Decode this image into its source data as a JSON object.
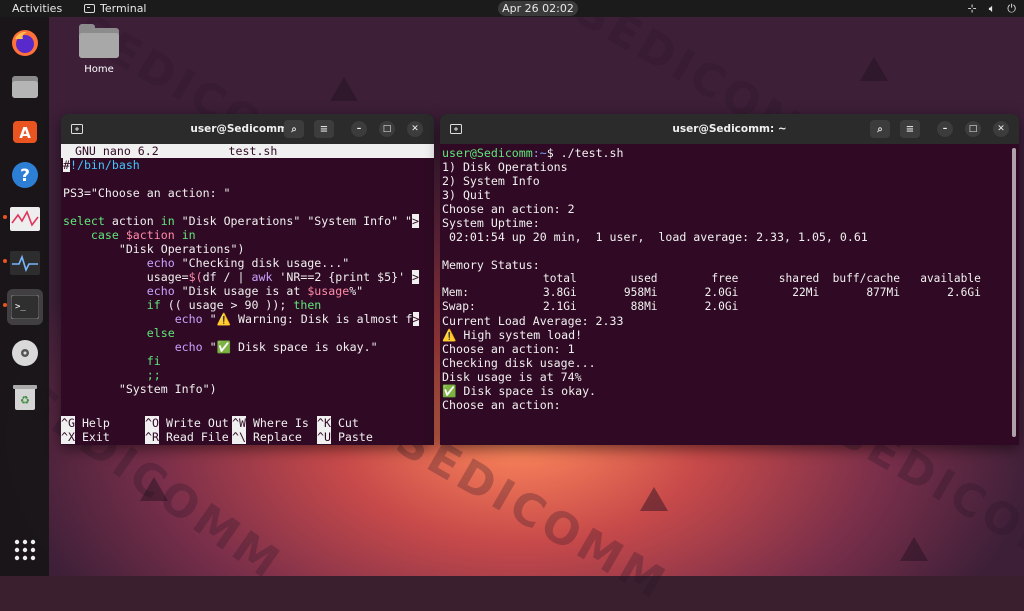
{
  "topbar": {
    "activities": "Activities",
    "app": "Terminal",
    "clock": "Apr 26  02:02"
  },
  "desktop": {
    "home_label": "Home",
    "watermark": "SEDICOMM"
  },
  "left_window": {
    "title": "user@Sedicomm: ~",
    "nano_header": "  GNU nano 6.2          test.sh",
    "lines": [
      "#!/bin/bash",
      "",
      "PS3=\"Choose an action: \"",
      "",
      "select action in \"Disk Operations\" \"System Info\" \"",
      "    case $action in",
      "        \"Disk Operations\")",
      "            echo \"Checking disk usage...\"",
      "            usage=$(df / | awk 'NR==2 {print $5}' ",
      "            echo \"Disk usage is at $usage%\"",
      "            if (( usage > 90 )); then",
      "                echo \"⚠️ Warning: Disk is almost f",
      "            else",
      "                echo \"✅ Disk space is okay.\"",
      "            fi",
      "            ;;",
      "        \"System Info\")"
    ],
    "shortcuts": [
      {
        "key": "^G",
        "label": "Help"
      },
      {
        "key": "^O",
        "label": "Write Out"
      },
      {
        "key": "^W",
        "label": "Where Is"
      },
      {
        "key": "^K",
        "label": "Cut"
      },
      {
        "key": "^X",
        "label": "Exit"
      },
      {
        "key": "^R",
        "label": "Read File"
      },
      {
        "key": "^\\",
        "label": "Replace"
      },
      {
        "key": "^U",
        "label": "Paste"
      }
    ]
  },
  "right_window": {
    "title": "user@Sedicomm: ~",
    "prompt_user": "user@Sedicomm",
    "prompt_path": ":~",
    "prompt_cmd": "$ ./test.sh",
    "lines": [
      "1) Disk Operations",
      "2) System Info",
      "3) Quit",
      "Choose an action: 2",
      "System Uptime:",
      " 02:01:54 up 20 min,  1 user,  load average: 2.33, 1.05, 0.61",
      "",
      "Memory Status:",
      "               total        used        free      shared  buff/cache   available",
      "Mem:           3.8Gi       958Mi       2.0Gi        22Mi       877Mi       2.6Gi",
      "Swap:          2.1Gi        88Mi       2.0Gi",
      "Current Load Average: 2.33",
      "⚠️ High system load!",
      "Choose an action: 1",
      "Checking disk usage...",
      "Disk usage is at 74%",
      "✅ Disk space is okay.",
      "Choose an action:"
    ]
  }
}
